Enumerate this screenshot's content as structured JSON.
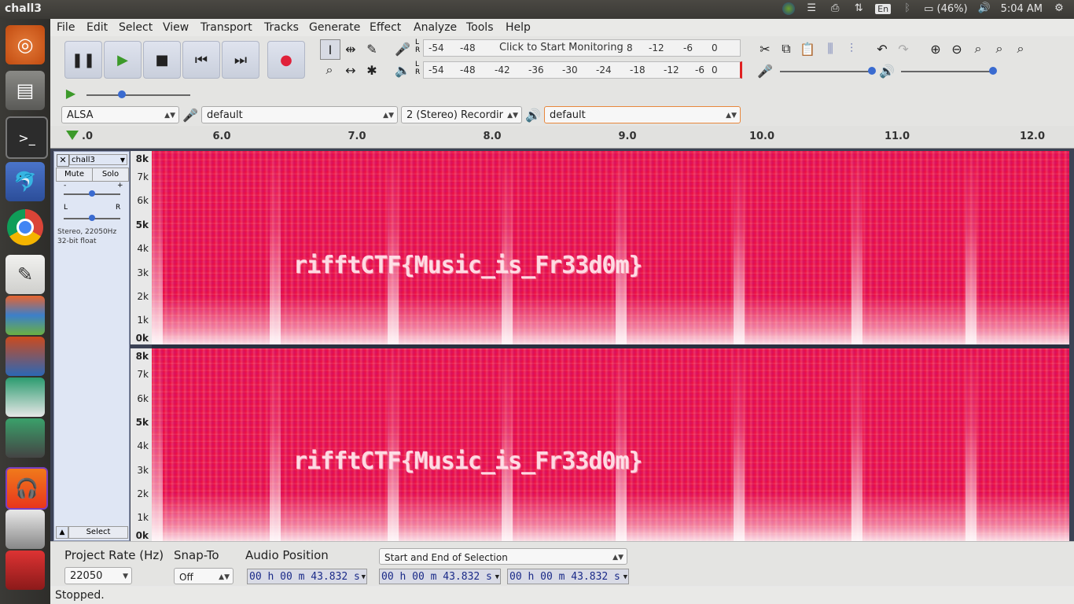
{
  "window": {
    "title": "chall3"
  },
  "tray": {
    "battery": "(46%)",
    "time": "5:04 AM",
    "lang": "En"
  },
  "menu": [
    "File",
    "Edit",
    "Select",
    "View",
    "Transport",
    "Tracks",
    "Generate",
    "Effect",
    "Analyze",
    "Tools",
    "Help"
  ],
  "meters": {
    "record_ticks": [
      "-54",
      "-48",
      "Click to Start Monitoring",
      "8",
      "-12",
      "-6",
      "0"
    ],
    "play_ticks": [
      "-54",
      "-48",
      "-42",
      "-36",
      "-30",
      "-24",
      "-18",
      "-12",
      "-6",
      "0"
    ],
    "record_channels": "L\nR",
    "play_channels": "L\nR"
  },
  "devices": {
    "host": "ALSA",
    "recording_device": "default",
    "channels": "2 (Stereo) Recordir",
    "playback_device": "default"
  },
  "ruler": {
    "ticks": [
      ".0",
      "6.0",
      "7.0",
      "8.0",
      "9.0",
      "10.0",
      "11.0",
      "12.0"
    ]
  },
  "track": {
    "name": "chall3",
    "mute": "Mute",
    "solo": "Solo",
    "gain_minus": "-",
    "gain_plus": "+",
    "pan_left": "L",
    "pan_right": "R",
    "info_line1": "Stereo, 22050Hz",
    "info_line2": "32-bit float",
    "select": "Select"
  },
  "freq_labels": [
    "8k",
    "7k",
    "6k",
    "5k",
    "4k",
    "3k",
    "2k",
    "1k",
    "0k"
  ],
  "spectrogram_text": "rifftCTF{Music_is_Fr33d0m}",
  "selection_toolbar": {
    "rate_label": "Project Rate (Hz)",
    "rate_value": "22050",
    "snap_label": "Snap-To",
    "snap_value": "Off",
    "position_label": "Audio Position",
    "selection_mode": "Start and End of Selection",
    "audio_position": "00 h 00 m 43.832 s",
    "sel_start": "00 h 00 m 43.832 s",
    "sel_end": "00 h 00 m 43.832 s"
  },
  "status": "Stopped.",
  "colors": {
    "spectrogram": "#ee1040",
    "accent": "#e0433a"
  }
}
